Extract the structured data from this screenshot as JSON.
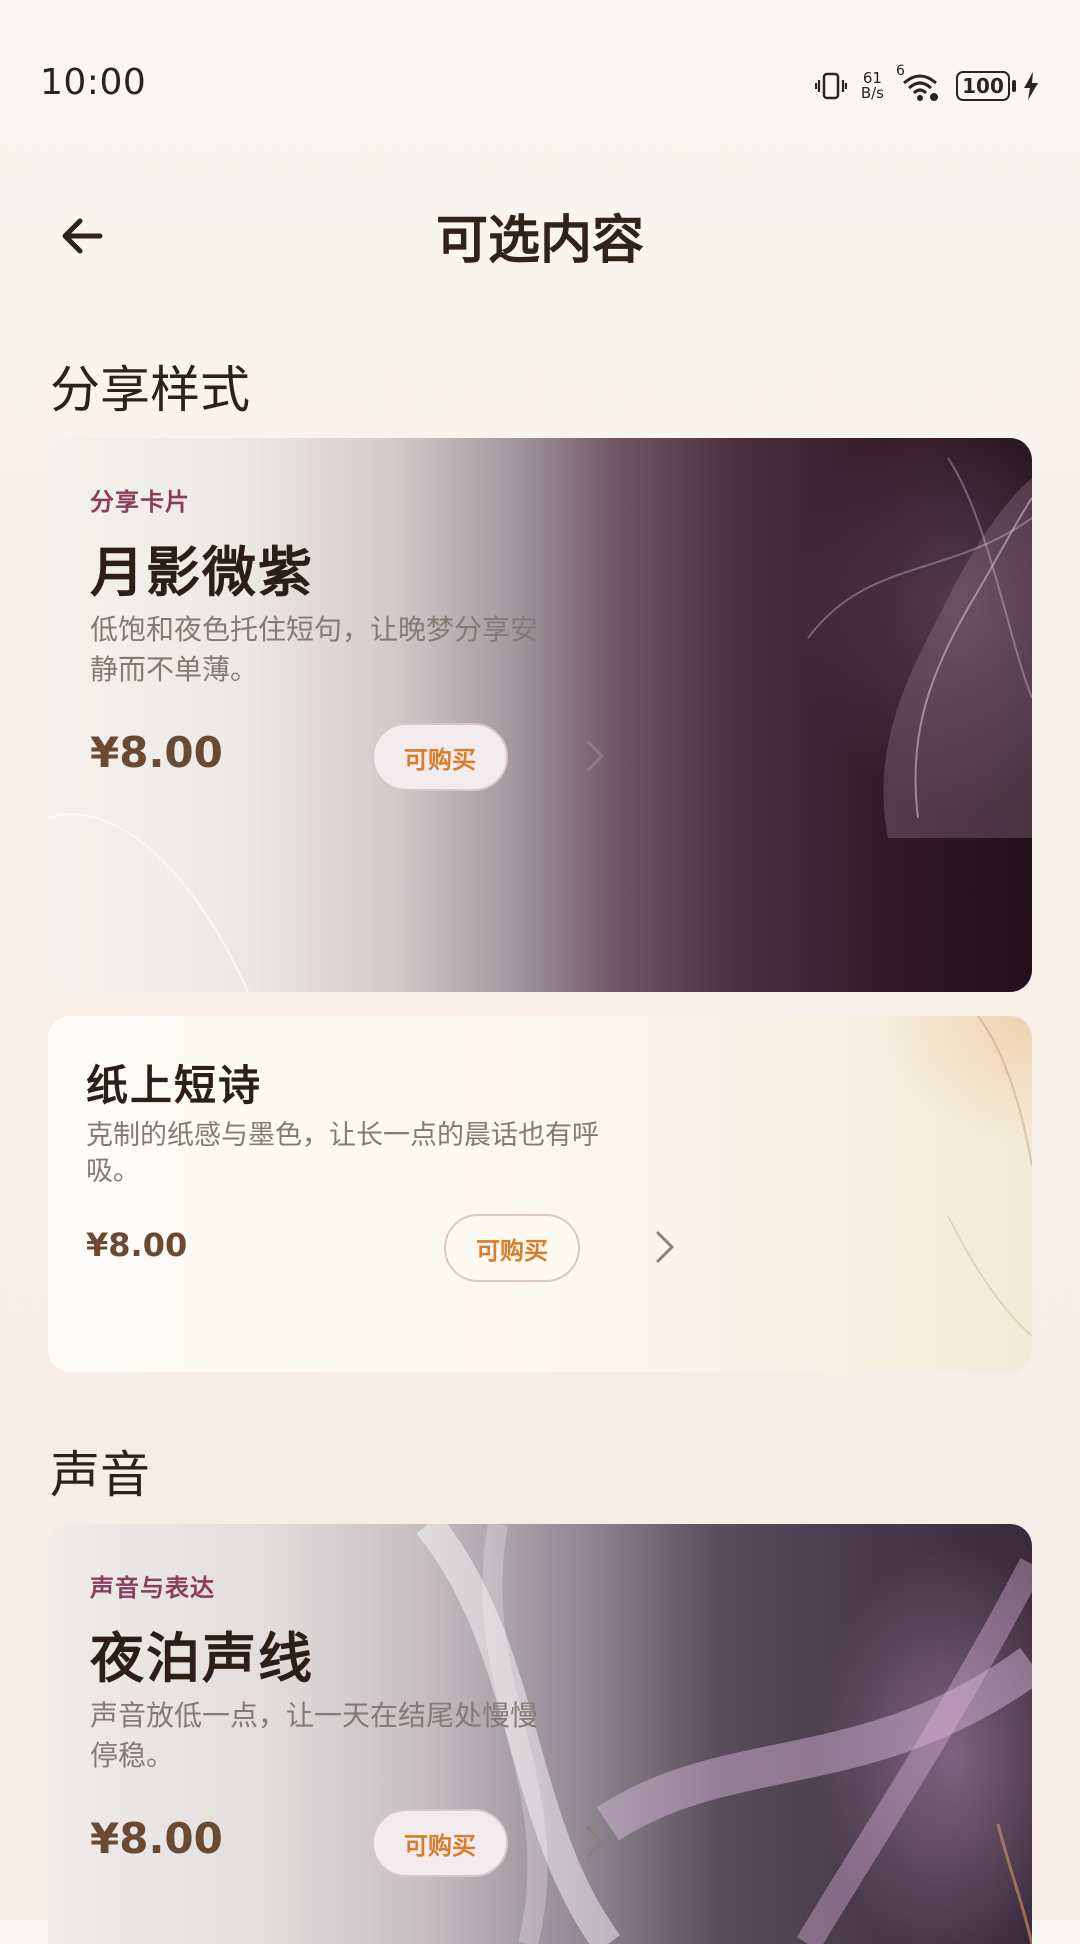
{
  "status_bar": {
    "time": "10:00",
    "net_speed_value": "61",
    "net_speed_unit": "B/s",
    "wifi_label": "6",
    "battery": "100"
  },
  "header": {
    "title": "可选内容",
    "back_icon": "arrow-left-icon"
  },
  "sections": [
    {
      "title": "分享样式",
      "cards": [
        {
          "eyebrow": "分享卡片",
          "title": "月影微紫",
          "description": "低饱和夜色托住短句，让晚梦分享安静而不单薄。",
          "price": "¥8.00",
          "button": "可购买",
          "theme_color": "#2a1420"
        },
        {
          "eyebrow": "",
          "title": "纸上短诗",
          "description": "克制的纸感与墨色，让长一点的晨话也有呼吸。",
          "price": "¥8.00",
          "button": "可购买",
          "theme_color": "#f6eee0"
        }
      ]
    },
    {
      "title": "声音",
      "cards": [
        {
          "eyebrow": "声音与表达",
          "title": "夜泊声线",
          "description": "声音放低一点，让一天在结尾处慢慢停稳。",
          "price": "¥8.00",
          "button": "可购买",
          "theme_color": "#4a3a4c"
        }
      ]
    }
  ],
  "colors": {
    "accent_orange": "#d87d2b",
    "eyebrow": "#8a3d5c",
    "price": "#6b4a33"
  }
}
